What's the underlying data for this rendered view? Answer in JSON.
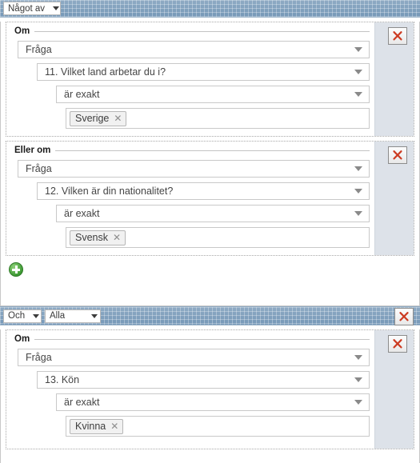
{
  "panel1": {
    "header": {
      "match_select": {
        "value": "Något av",
        "icon": "chevron-down-icon"
      }
    },
    "groups": [
      {
        "legend": "Om",
        "close_icon": "red-x-icon",
        "rows": [
          {
            "type": "select",
            "value": "Fråga",
            "icon": "caret-down-icon"
          },
          {
            "type": "select",
            "value": "11. Vilket land arbetar du i?",
            "icon": "caret-down-icon"
          },
          {
            "type": "select",
            "value": "är exakt",
            "icon": "caret-down-icon"
          },
          {
            "type": "chips",
            "chips": [
              {
                "label": "Sverige",
                "remove_icon": "close-x-icon"
              }
            ]
          }
        ]
      },
      {
        "legend": "Eller om",
        "close_icon": "red-x-icon",
        "rows": [
          {
            "type": "select",
            "value": "Fråga",
            "icon": "caret-down-icon"
          },
          {
            "type": "select",
            "value": "12. Vilken är din nationalitet?",
            "icon": "caret-down-icon"
          },
          {
            "type": "select",
            "value": "är exakt",
            "icon": "caret-down-icon"
          },
          {
            "type": "chips",
            "chips": [
              {
                "label": "Svensk",
                "remove_icon": "close-x-icon"
              }
            ]
          }
        ]
      }
    ],
    "add_button": {
      "icon": "green-plus-icon",
      "label": ""
    }
  },
  "panel2": {
    "header": {
      "operator_select": {
        "value": "Och",
        "icon": "chevron-down-icon"
      },
      "match_select": {
        "value": "Alla",
        "icon": "chevron-down-icon"
      },
      "close_icon": "red-x-icon"
    },
    "groups": [
      {
        "legend": "Om",
        "close_icon": "red-x-icon",
        "rows": [
          {
            "type": "select",
            "value": "Fråga",
            "icon": "caret-down-icon"
          },
          {
            "type": "select",
            "value": "13. Kön",
            "icon": "caret-down-icon"
          },
          {
            "type": "select",
            "value": "är exakt",
            "icon": "caret-down-icon"
          },
          {
            "type": "chips",
            "chips": [
              {
                "label": "Kvinna",
                "remove_icon": "close-x-icon"
              }
            ]
          }
        ]
      }
    ]
  },
  "colors": {
    "header_blue": "#6f93b4",
    "rail_gray": "#dde2e9",
    "close_red": "#cc3b22",
    "add_green": "#3f9b35"
  }
}
